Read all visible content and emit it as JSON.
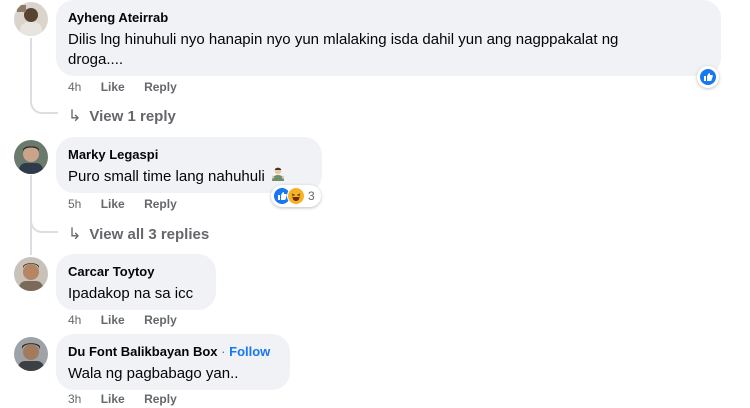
{
  "colors": {
    "bubble": "#f0f2f5",
    "link": "#1877f2",
    "meta": "#65676b",
    "like": "#1877f2",
    "haha": "#f7b125"
  },
  "comments": [
    {
      "author": "Ayheng Ateirrab",
      "text_line1": "Dilis lng hinuhuli nyo hanapin nyo yun mlalaking isda dahil yun ang nagppakalat ng",
      "text_line2": "droga....",
      "time": "4h",
      "like": "Like",
      "reply": "Reply",
      "reactions": "like-icon",
      "view_replies": "View 1 reply"
    },
    {
      "author": "Marky Legaspi",
      "text": "Puro small time lang nahuhuli",
      "emoji": "man-shrugging-emoji",
      "time": "5h",
      "like": "Like",
      "reply": "Reply",
      "reaction_count": "3",
      "view_replies": "View all 3 replies"
    },
    {
      "author": "Carcar Toytoy",
      "text": "Ipadakop na sa icc",
      "time": "4h",
      "like": "Like",
      "reply": "Reply"
    },
    {
      "author": "Du Font Balikbayan Box",
      "follow": "Follow",
      "separator": "·",
      "text": "Wala ng pagbabago yan..",
      "time": "3h",
      "like": "Like",
      "reply": "Reply"
    }
  ]
}
